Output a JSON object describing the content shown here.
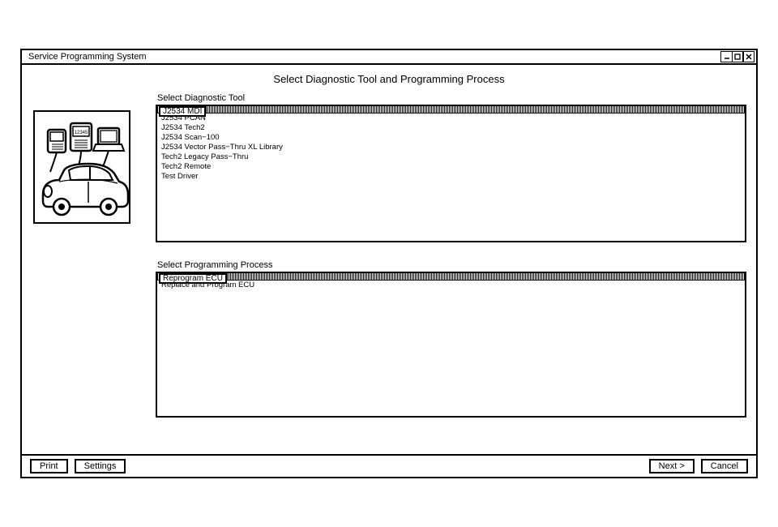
{
  "window_title": "Service Programming System",
  "page_title": "Select Diagnostic Tool and Programming Process",
  "illustration_text": "12345",
  "section1": {
    "label": "Select Diagnostic Tool",
    "selected": "J2534 MDI",
    "items": [
      "J2534 PCAN",
      "J2534 Tech2",
      "J2534 Scan−100",
      "J2534 Vector Pass−Thru XL Library",
      "Tech2 Legacy Pass−Thru",
      "Tech2 Remote",
      "Test Driver"
    ]
  },
  "section2": {
    "label": "Select Programming Process",
    "selected": "Reprogram ECU",
    "items": [
      "Replace and Program ECU"
    ]
  },
  "buttons": {
    "print": "Print",
    "settings": "Settings",
    "next": "Next >",
    "cancel": "Cancel"
  }
}
